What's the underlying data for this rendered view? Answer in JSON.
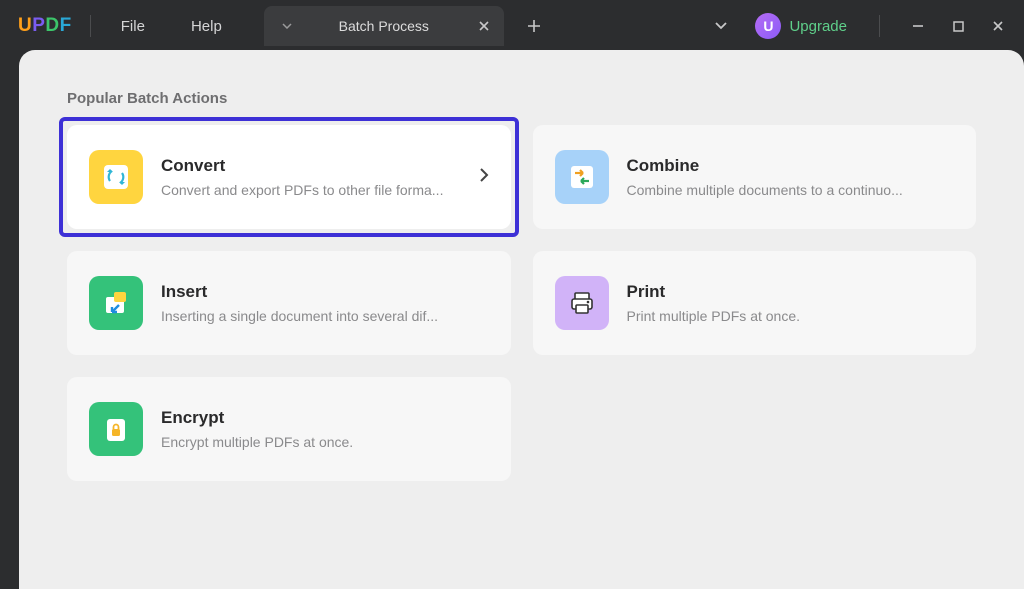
{
  "app": {
    "logo_letters": {
      "u": "U",
      "p": "P",
      "d": "D",
      "f": "F"
    }
  },
  "menubar": {
    "file": "File",
    "help": "Help"
  },
  "tab": {
    "label": "Batch Process"
  },
  "upgrade": {
    "badge_letter": "U",
    "label": "Upgrade"
  },
  "section": {
    "title": "Popular Batch Actions"
  },
  "cards": {
    "convert": {
      "title": "Convert",
      "desc": "Convert and export PDFs to other file forma..."
    },
    "combine": {
      "title": "Combine",
      "desc": "Combine multiple documents to a continuo..."
    },
    "insert": {
      "title": "Insert",
      "desc": "Inserting a single document into several dif..."
    },
    "print": {
      "title": "Print",
      "desc": "Print multiple PDFs at once."
    },
    "encrypt": {
      "title": "Encrypt",
      "desc": "Encrypt multiple PDFs at once."
    }
  }
}
